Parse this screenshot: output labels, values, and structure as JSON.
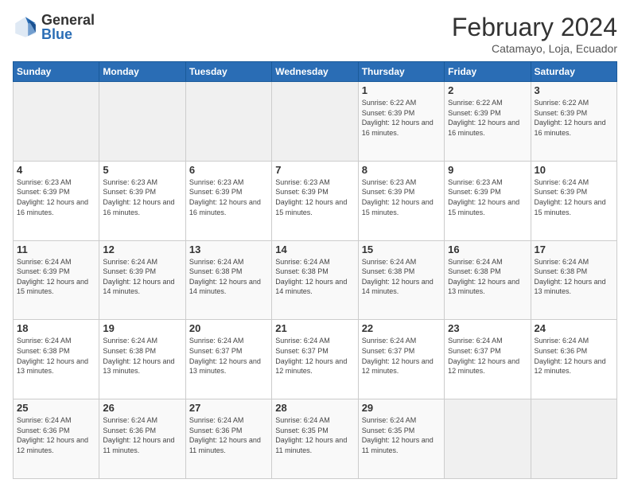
{
  "logo": {
    "general": "General",
    "blue": "Blue"
  },
  "title": "February 2024",
  "subtitle": "Catamayo, Loja, Ecuador",
  "weekdays": [
    "Sunday",
    "Monday",
    "Tuesday",
    "Wednesday",
    "Thursday",
    "Friday",
    "Saturday"
  ],
  "weeks": [
    [
      {
        "day": "",
        "info": ""
      },
      {
        "day": "",
        "info": ""
      },
      {
        "day": "",
        "info": ""
      },
      {
        "day": "",
        "info": ""
      },
      {
        "day": "1",
        "info": "Sunrise: 6:22 AM\nSunset: 6:39 PM\nDaylight: 12 hours and 16 minutes."
      },
      {
        "day": "2",
        "info": "Sunrise: 6:22 AM\nSunset: 6:39 PM\nDaylight: 12 hours and 16 minutes."
      },
      {
        "day": "3",
        "info": "Sunrise: 6:22 AM\nSunset: 6:39 PM\nDaylight: 12 hours and 16 minutes."
      }
    ],
    [
      {
        "day": "4",
        "info": "Sunrise: 6:23 AM\nSunset: 6:39 PM\nDaylight: 12 hours and 16 minutes."
      },
      {
        "day": "5",
        "info": "Sunrise: 6:23 AM\nSunset: 6:39 PM\nDaylight: 12 hours and 16 minutes."
      },
      {
        "day": "6",
        "info": "Sunrise: 6:23 AM\nSunset: 6:39 PM\nDaylight: 12 hours and 16 minutes."
      },
      {
        "day": "7",
        "info": "Sunrise: 6:23 AM\nSunset: 6:39 PM\nDaylight: 12 hours and 15 minutes."
      },
      {
        "day": "8",
        "info": "Sunrise: 6:23 AM\nSunset: 6:39 PM\nDaylight: 12 hours and 15 minutes."
      },
      {
        "day": "9",
        "info": "Sunrise: 6:23 AM\nSunset: 6:39 PM\nDaylight: 12 hours and 15 minutes."
      },
      {
        "day": "10",
        "info": "Sunrise: 6:24 AM\nSunset: 6:39 PM\nDaylight: 12 hours and 15 minutes."
      }
    ],
    [
      {
        "day": "11",
        "info": "Sunrise: 6:24 AM\nSunset: 6:39 PM\nDaylight: 12 hours and 15 minutes."
      },
      {
        "day": "12",
        "info": "Sunrise: 6:24 AM\nSunset: 6:39 PM\nDaylight: 12 hours and 14 minutes."
      },
      {
        "day": "13",
        "info": "Sunrise: 6:24 AM\nSunset: 6:38 PM\nDaylight: 12 hours and 14 minutes."
      },
      {
        "day": "14",
        "info": "Sunrise: 6:24 AM\nSunset: 6:38 PM\nDaylight: 12 hours and 14 minutes."
      },
      {
        "day": "15",
        "info": "Sunrise: 6:24 AM\nSunset: 6:38 PM\nDaylight: 12 hours and 14 minutes."
      },
      {
        "day": "16",
        "info": "Sunrise: 6:24 AM\nSunset: 6:38 PM\nDaylight: 12 hours and 13 minutes."
      },
      {
        "day": "17",
        "info": "Sunrise: 6:24 AM\nSunset: 6:38 PM\nDaylight: 12 hours and 13 minutes."
      }
    ],
    [
      {
        "day": "18",
        "info": "Sunrise: 6:24 AM\nSunset: 6:38 PM\nDaylight: 12 hours and 13 minutes."
      },
      {
        "day": "19",
        "info": "Sunrise: 6:24 AM\nSunset: 6:38 PM\nDaylight: 12 hours and 13 minutes."
      },
      {
        "day": "20",
        "info": "Sunrise: 6:24 AM\nSunset: 6:37 PM\nDaylight: 12 hours and 13 minutes."
      },
      {
        "day": "21",
        "info": "Sunrise: 6:24 AM\nSunset: 6:37 PM\nDaylight: 12 hours and 12 minutes."
      },
      {
        "day": "22",
        "info": "Sunrise: 6:24 AM\nSunset: 6:37 PM\nDaylight: 12 hours and 12 minutes."
      },
      {
        "day": "23",
        "info": "Sunrise: 6:24 AM\nSunset: 6:37 PM\nDaylight: 12 hours and 12 minutes."
      },
      {
        "day": "24",
        "info": "Sunrise: 6:24 AM\nSunset: 6:36 PM\nDaylight: 12 hours and 12 minutes."
      }
    ],
    [
      {
        "day": "25",
        "info": "Sunrise: 6:24 AM\nSunset: 6:36 PM\nDaylight: 12 hours and 12 minutes."
      },
      {
        "day": "26",
        "info": "Sunrise: 6:24 AM\nSunset: 6:36 PM\nDaylight: 12 hours and 11 minutes."
      },
      {
        "day": "27",
        "info": "Sunrise: 6:24 AM\nSunset: 6:36 PM\nDaylight: 12 hours and 11 minutes."
      },
      {
        "day": "28",
        "info": "Sunrise: 6:24 AM\nSunset: 6:35 PM\nDaylight: 12 hours and 11 minutes."
      },
      {
        "day": "29",
        "info": "Sunrise: 6:24 AM\nSunset: 6:35 PM\nDaylight: 12 hours and 11 minutes."
      },
      {
        "day": "",
        "info": ""
      },
      {
        "day": "",
        "info": ""
      }
    ]
  ]
}
